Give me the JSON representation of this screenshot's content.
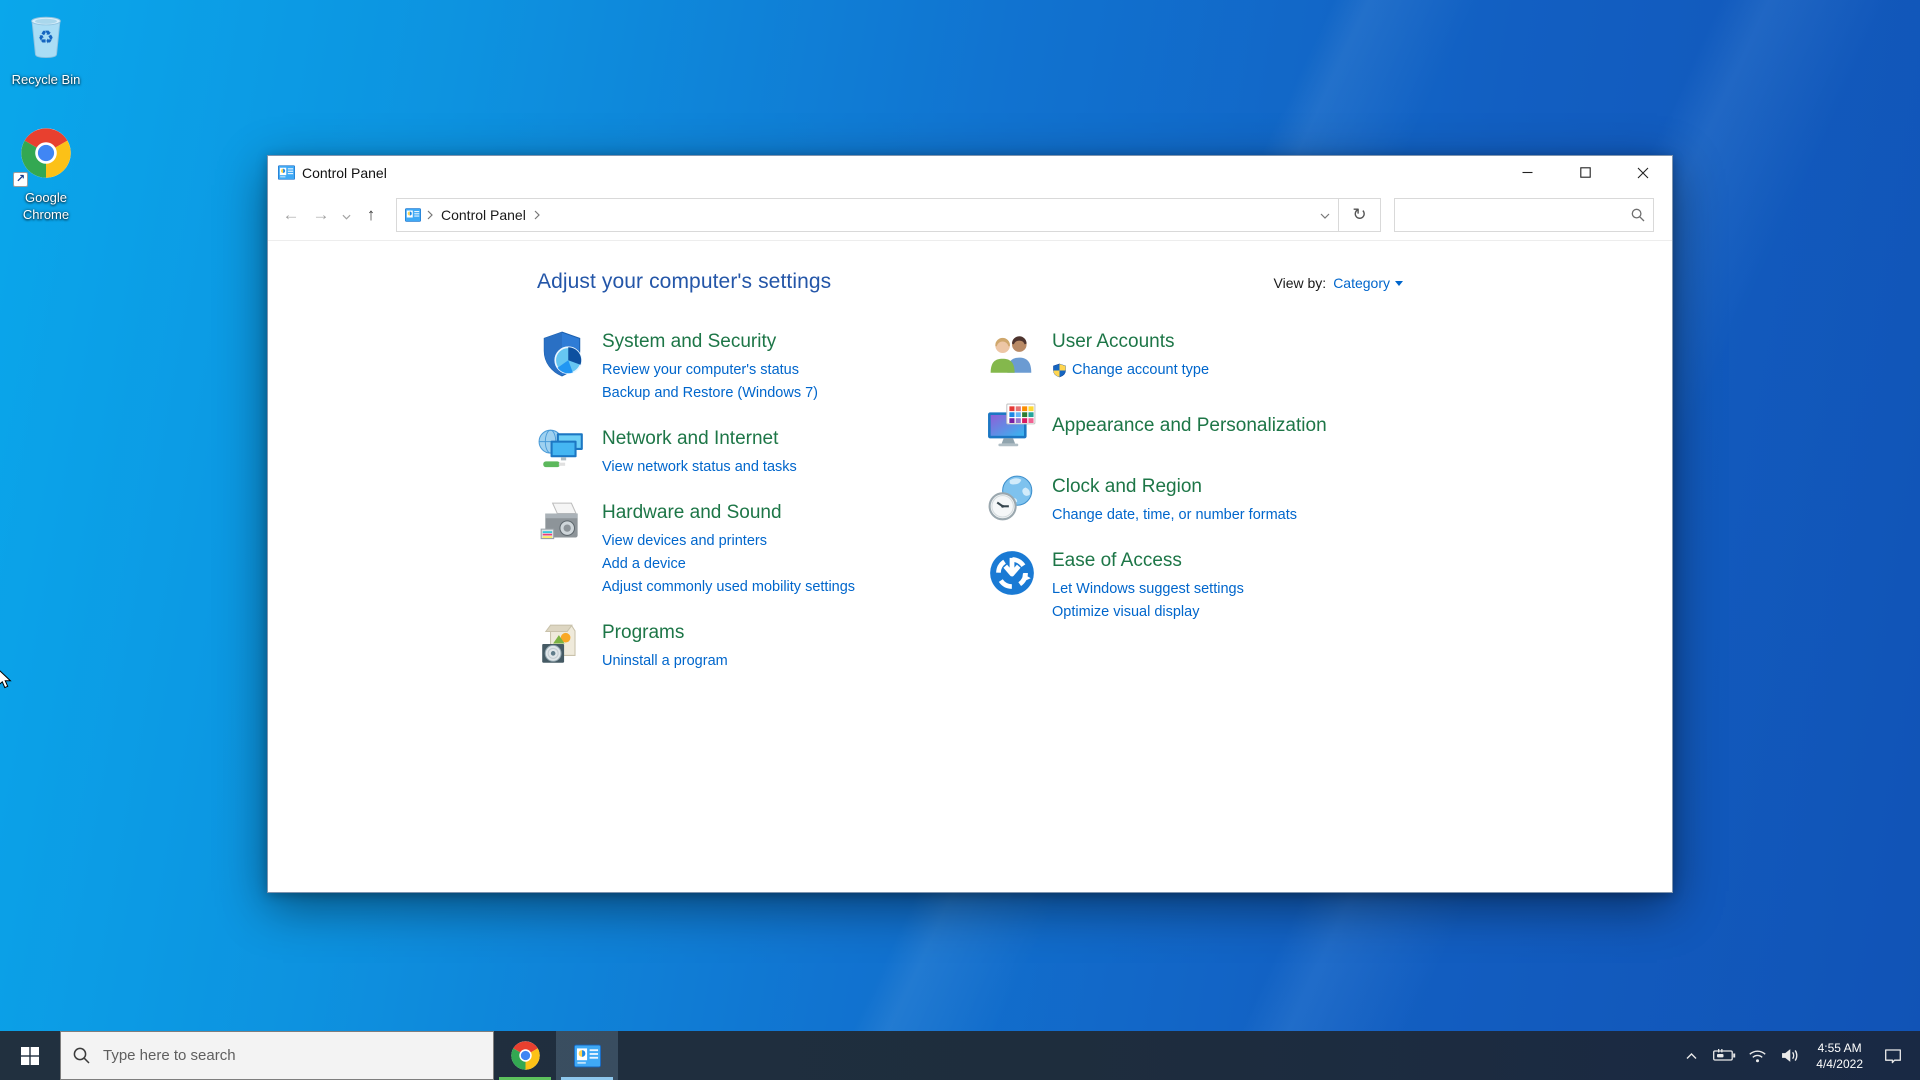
{
  "glyphs": {
    "back": "←",
    "forward": "→",
    "up": "↑",
    "refresh": "↻",
    "recycle": "♻",
    "shortcut_arrow": "↗"
  },
  "desktop": {
    "icons": [
      {
        "label": "Recycle Bin"
      },
      {
        "label_lines": [
          "Google",
          "Chrome"
        ]
      }
    ]
  },
  "window": {
    "title": "Control Panel",
    "breadcrumb": {
      "root": "Control Panel"
    },
    "search_value": "",
    "heading": "Adjust your computer's settings",
    "view_by": {
      "label": "View by:",
      "value": "Category"
    },
    "left": [
      {
        "name": "System and Security",
        "links": [
          "Review your computer's status",
          "Backup and Restore (Windows 7)"
        ]
      },
      {
        "name": "Network and Internet",
        "links": [
          "View network status and tasks"
        ]
      },
      {
        "name": "Hardware and Sound",
        "links": [
          "View devices and printers",
          "Add a device",
          "Adjust commonly used mobility settings"
        ]
      },
      {
        "name": "Programs",
        "links": [
          "Uninstall a program"
        ]
      }
    ],
    "right": [
      {
        "name": "User Accounts",
        "links": [
          "Change account type"
        ]
      },
      {
        "name": "Appearance and Personalization",
        "links": []
      },
      {
        "name": "Clock and Region",
        "links": [
          "Change date, time, or number formats"
        ]
      },
      {
        "name": "Ease of Access",
        "links": [
          "Let Windows suggest settings",
          "Optimize visual display"
        ]
      }
    ]
  },
  "taskbar": {
    "search_placeholder": "Type here to search",
    "clock": {
      "time": "4:55 AM",
      "date": "4/4/2022"
    }
  },
  "colors": {
    "category_heading": "#1d7647",
    "link": "#0066cc",
    "main_heading": "#2456a8",
    "chrome_underline": "#5dc25d",
    "control_panel_underline": "#8ec8ee"
  }
}
